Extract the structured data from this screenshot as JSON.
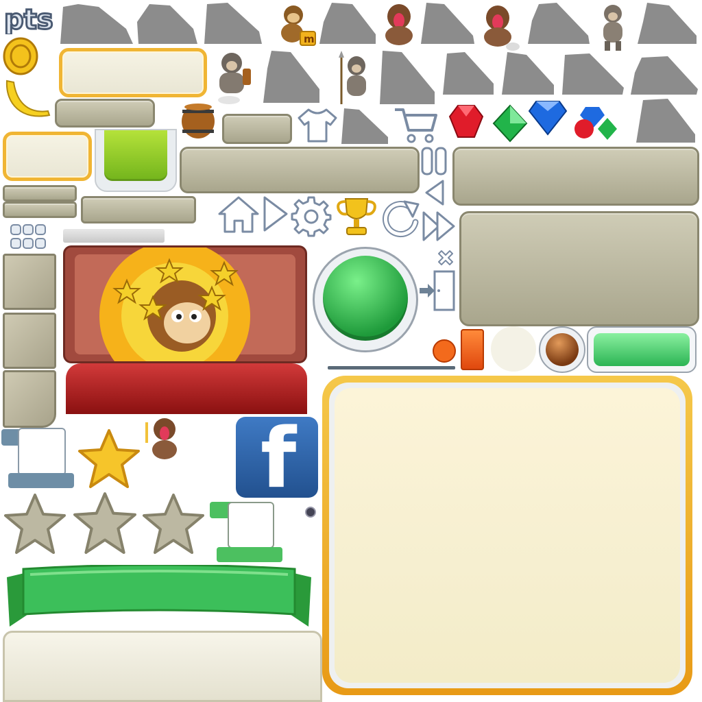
{
  "sheet": {
    "logo_text": "pts",
    "badge_letter": "m",
    "facebook_letter": "f"
  },
  "colors": {
    "tan_panel": "#bdb9a1",
    "tan_border": "#8a876f",
    "gold_border": "#f0b534",
    "cream": "#f6f3e4",
    "green": "#3cbf5a",
    "red_banner": "#a01818",
    "facebook_blue": "#2b62a8",
    "silhouette": "#8c8c8c"
  },
  "icons": [
    "coin-icon",
    "banana-icon",
    "barrel-icon",
    "shirt-icon",
    "cart-icon",
    "ruby-gem-icon",
    "emerald-gem-icon",
    "diamond-gem-icon",
    "gem-pile-icon",
    "home-icon",
    "play-icon",
    "gear-icon",
    "trophy-icon",
    "restart-icon",
    "fast-forward-icon",
    "pause-icon",
    "back-arrow-icon",
    "close-icon",
    "exit-door-icon",
    "star-icon",
    "facebook-icon",
    "grid-menu-icon"
  ]
}
